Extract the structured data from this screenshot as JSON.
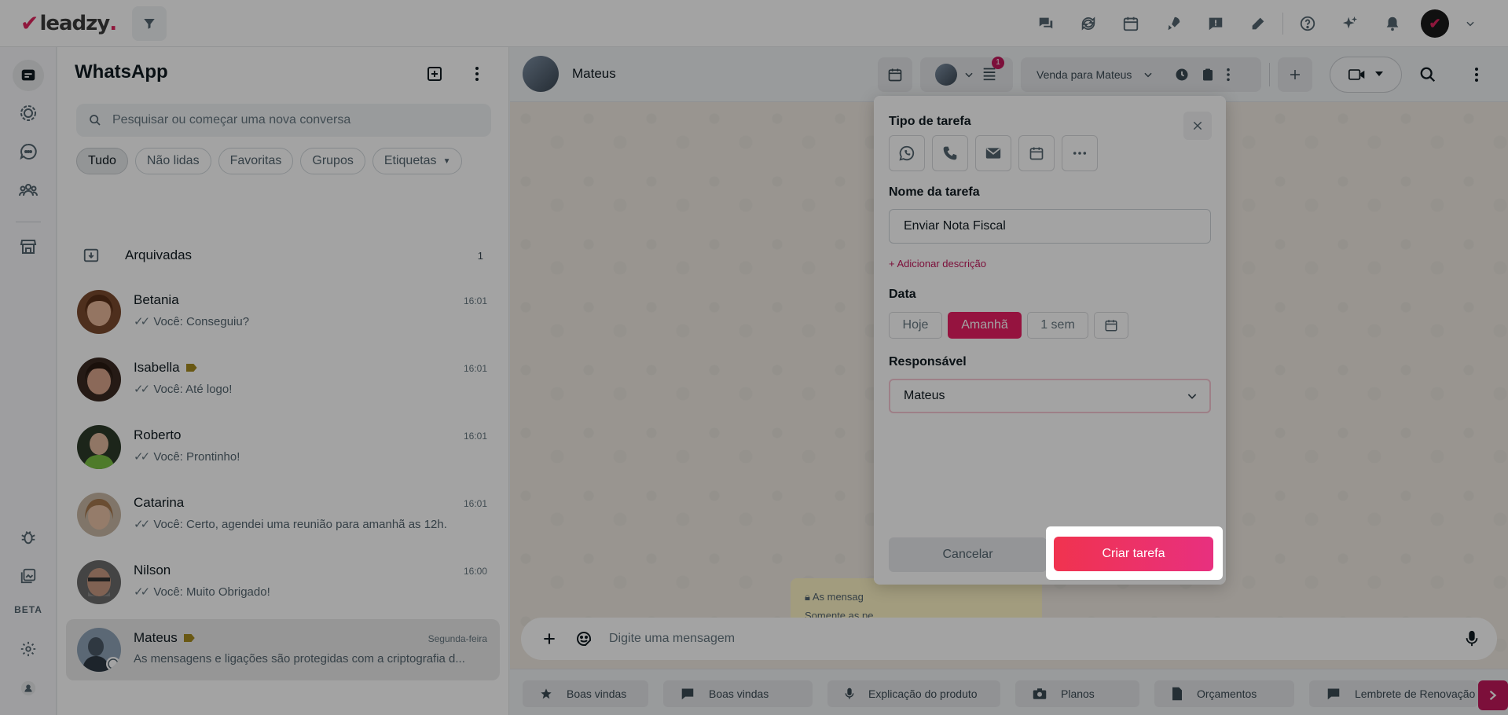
{
  "app": {
    "logo_text": "leadzy",
    "brand_color": "#e0245e"
  },
  "topbar": {
    "icons": [
      "chat-bubbles-icon",
      "sync-icon",
      "calendar-icon",
      "rocket-icon",
      "message-alert-icon",
      "pen-icon",
      "help-icon",
      "sparkles-icon",
      "bell-icon"
    ]
  },
  "rail": {
    "beta_label": "BETA"
  },
  "chatlist": {
    "title": "WhatsApp",
    "search_placeholder": "Pesquisar ou começar uma nova conversa",
    "filters": [
      "Tudo",
      "Não lidas",
      "Favoritas",
      "Grupos",
      "Etiquetas"
    ],
    "archived_label": "Arquivadas",
    "archived_count": "1",
    "chats": [
      {
        "name": "Betania",
        "time": "16:01",
        "message": "Você: Conseguiu?",
        "tag": false
      },
      {
        "name": "Isabella",
        "time": "16:01",
        "message": "Você: Até logo!",
        "tag": true
      },
      {
        "name": "Roberto",
        "time": "16:01",
        "message": "Você: Prontinho!",
        "tag": false
      },
      {
        "name": "Catarina",
        "time": "16:01",
        "message": "Você: Certo, agendei uma reunião para amanhã as 12h.",
        "tag": false
      },
      {
        "name": "Nilson",
        "time": "16:00",
        "message": "Você: Muito Obrigado!",
        "tag": false
      },
      {
        "name": "Mateus",
        "time": "Segunda-feira",
        "message": "As mensagens e ligações são protegidas com a criptografia d...",
        "tag": true
      }
    ]
  },
  "conversation": {
    "contact_name": "Mateus",
    "badge_count": "1",
    "deal_label": "Venda para Mateus",
    "encryption_line1": "As mensag",
    "encryption_line2": "Somente as pe",
    "composer_placeholder": "Digite uma mensagem",
    "quick_replies": [
      {
        "icon": "star-icon",
        "label": "Boas vindas"
      },
      {
        "icon": "chat-icon",
        "label": "Boas vindas"
      },
      {
        "icon": "microphone-icon",
        "label": "Explicação do produto"
      },
      {
        "icon": "camera-icon",
        "label": "Planos"
      },
      {
        "icon": "document-icon",
        "label": "Orçamentos"
      },
      {
        "icon": "chat-icon",
        "label": "Lembrete de Renovação d"
      }
    ]
  },
  "task_modal": {
    "type_label": "Tipo de tarefa",
    "type_icons": [
      "whatsapp-icon",
      "phone-icon",
      "email-icon",
      "calendar-icon",
      "more-icon"
    ],
    "name_label": "Nome da tarefa",
    "name_value": "Enviar Nota Fiscal",
    "add_description": "+ Adicionar descrição",
    "date_label": "Data",
    "date_options": [
      "Hoje",
      "Amanhã",
      "1 sem"
    ],
    "date_selected": "Amanhã",
    "owner_label": "Responsável",
    "owner_value": "Mateus",
    "cancel_label": "Cancelar",
    "create_label": "Criar tarefa"
  }
}
